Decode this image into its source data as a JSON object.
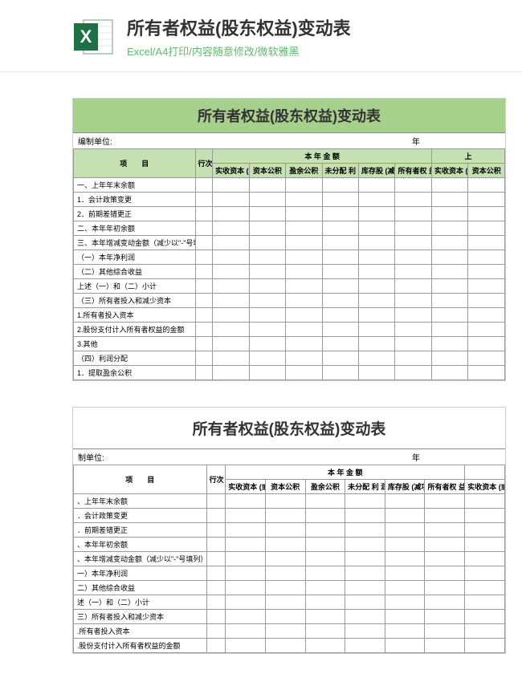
{
  "header": {
    "title": "所有者权益(股东权益)变动表",
    "subtitle": "Excel/A4打印/内容随意修改/微软雅黑"
  },
  "sheet": {
    "title": "所有者权益(股东权益)变动表",
    "unit_label": "编制单位:",
    "unit_label2": "制单位:",
    "year_label": "年",
    "header_item": "项　　目",
    "header_num": "行次",
    "header_group": "本 年 金 额",
    "header_group_right": "上",
    "cols": {
      "c1": "实收资本 (或股本)",
      "c2": "资本公积",
      "c3": "盈余公积",
      "c4": "未分配 利 润",
      "c5": "库存股 (减项)",
      "c6": "所有者权 益 合计",
      "c7": "实收资本 (或股本)",
      "c8": "资本公积"
    },
    "rows": [
      "一、上年年末余额",
      "1．会计政策变更",
      "2．前期差错更正",
      "二、本年年初余额",
      "三、本年增减变动金额（减少以\"-\"号填列）",
      "（一）本年净利润",
      "（二）其他综合收益",
      "上述（一）和（二）小计",
      "（三）所有者投入和减少资本",
      "1.所有者投入资本",
      "2.股份支付计入所有者权益的金额",
      "3.其他",
      "（四）利润分配",
      "1．提取盈余公积"
    ],
    "rows2": [
      "、上年年末余额",
      "．会计政策变更",
      "．前期差错更正",
      "、本年年初余额",
      "、本年增减变动金额（减少以\"-\"号填列）",
      "一）本年净利润",
      "二）其他综合收益",
      "述（一）和（二）小计",
      "三）所有者投入和减少资本",
      ".所有者投入资本",
      ".股份支付计入所有者权益的金额"
    ]
  }
}
